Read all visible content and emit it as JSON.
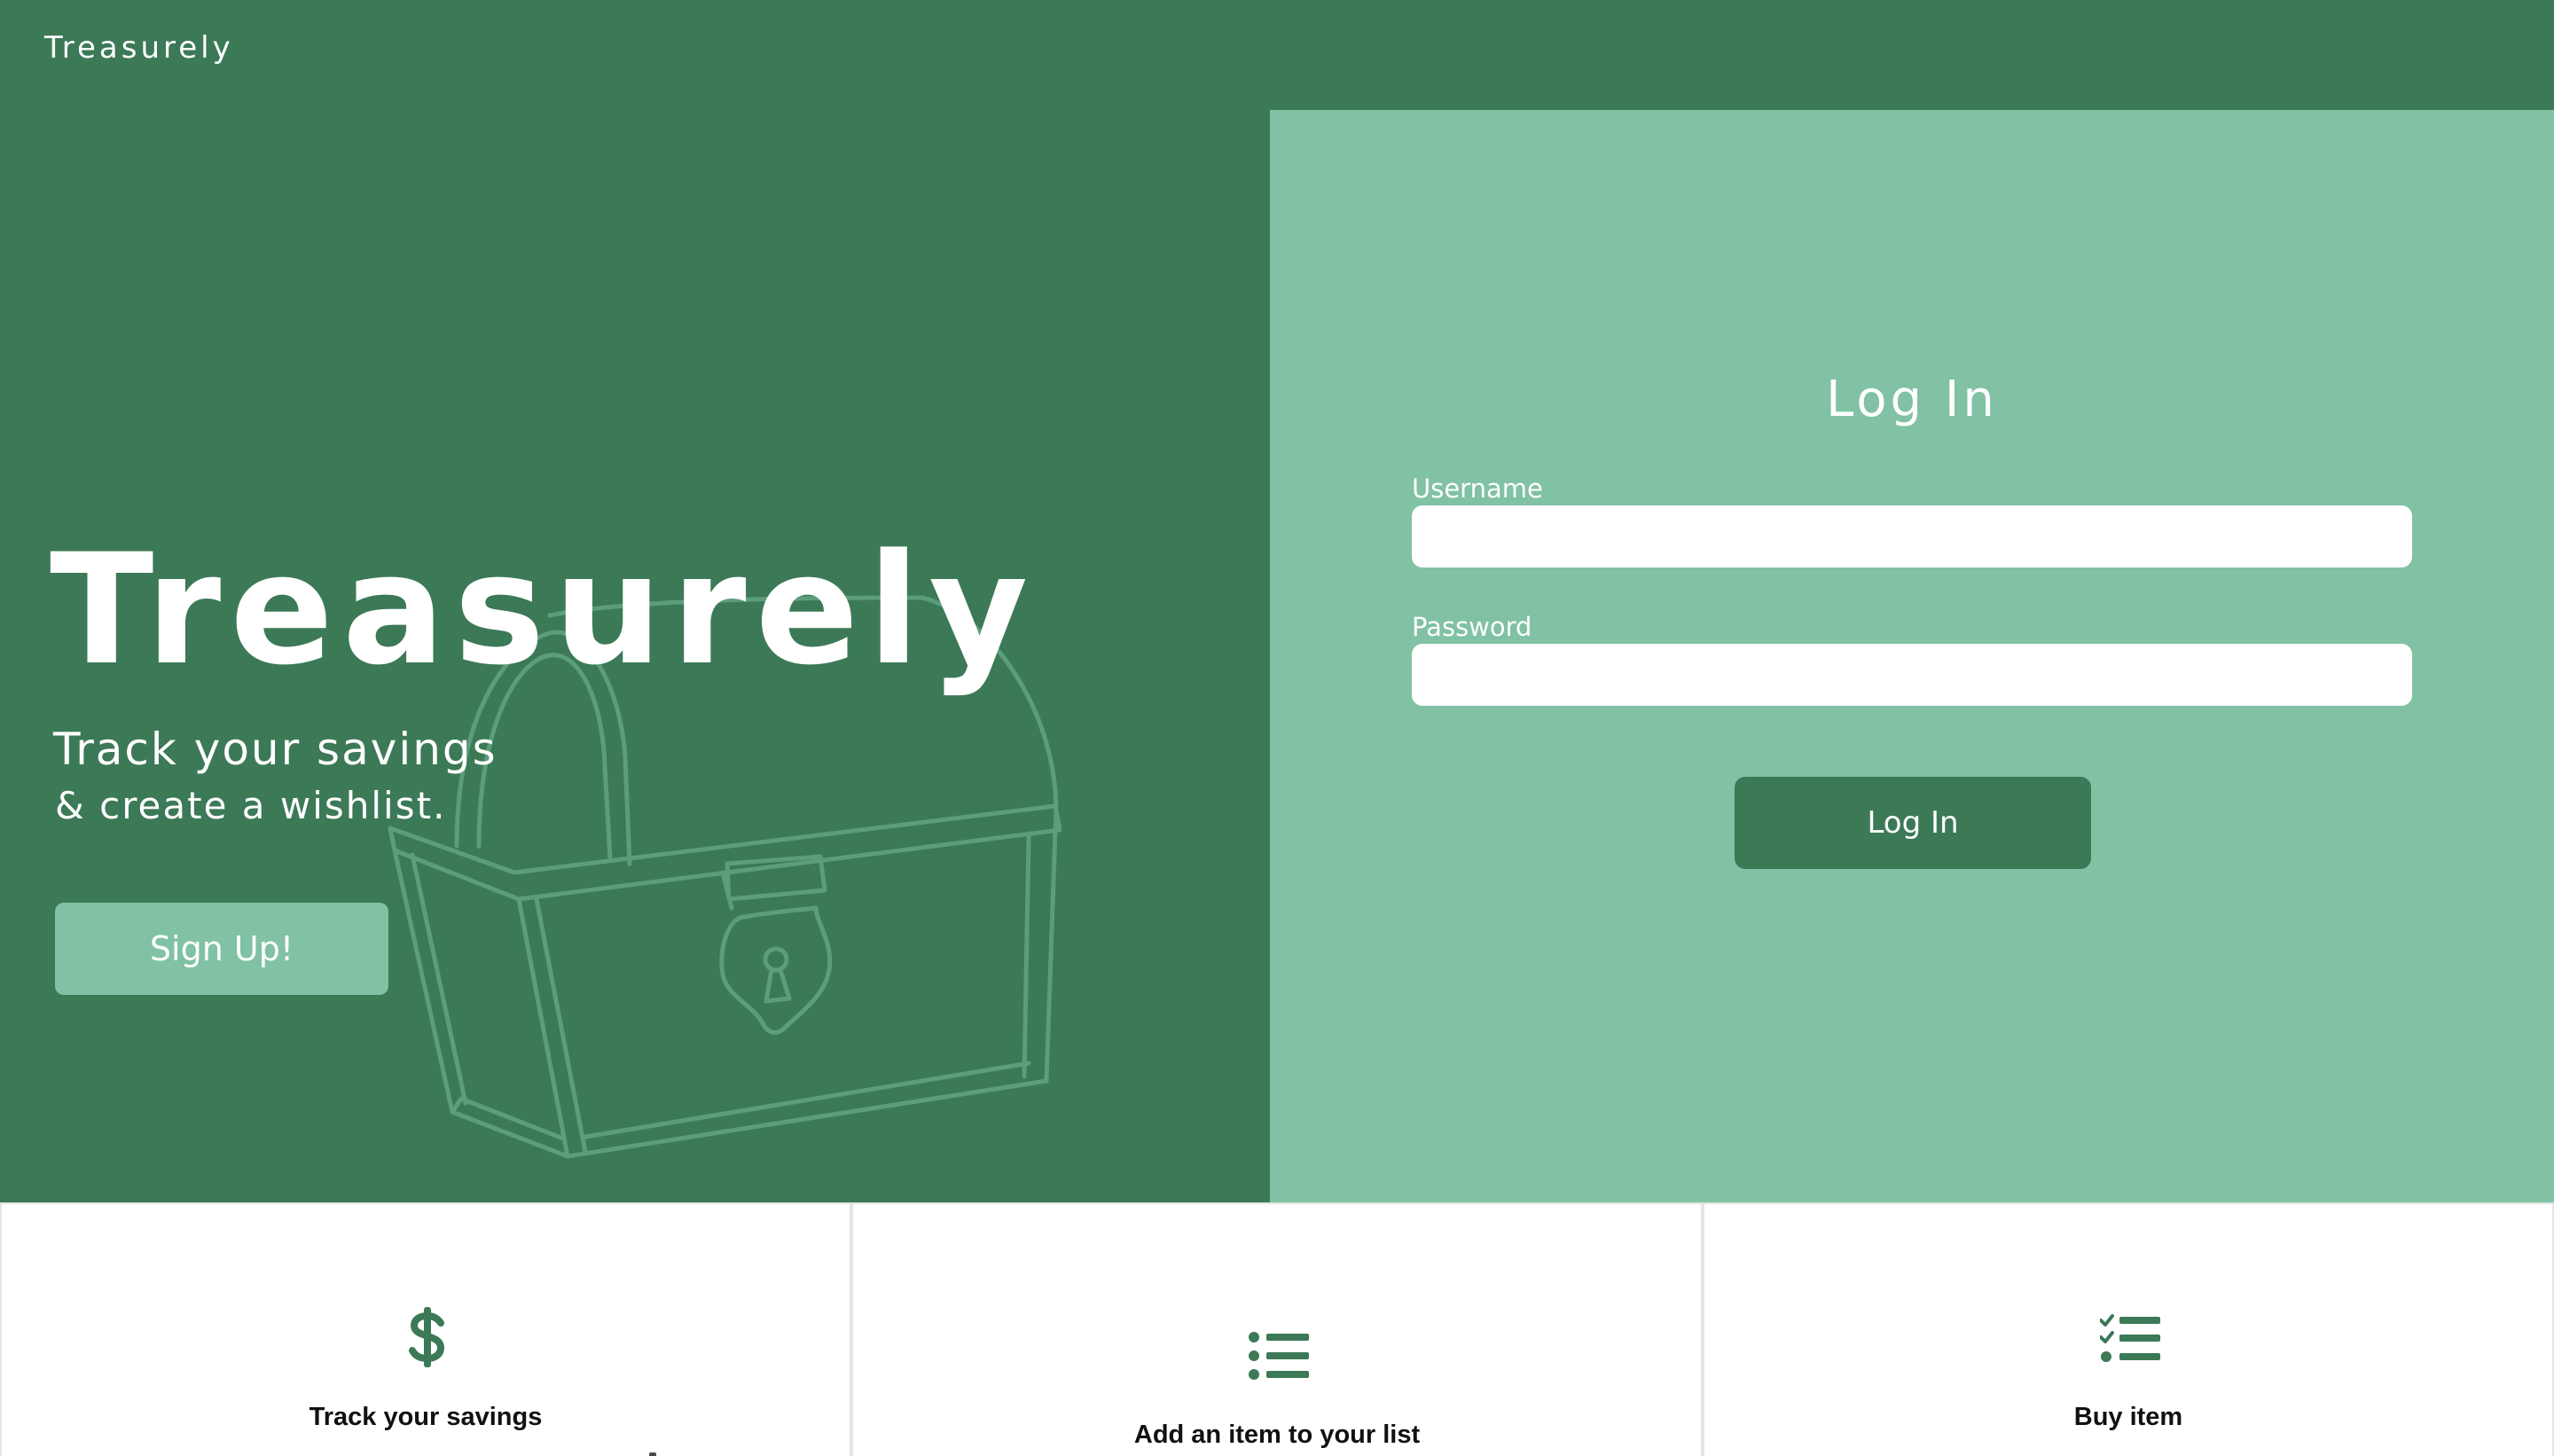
{
  "nav": {
    "brand": "Treasurely"
  },
  "hero": {
    "title": "Treasurely",
    "subtitle_line1": "Track your savings",
    "subtitle_line2": "& create a wishlist.",
    "signup_label": "Sign Up!",
    "illustration": "treasure-chest-icon"
  },
  "login": {
    "title": "Log In",
    "username_label": "Username",
    "username_value": "",
    "password_label": "Password",
    "password_value": "",
    "button_label": "Log In"
  },
  "features": [
    {
      "label": "Track your savings",
      "icon": "dollar-icon"
    },
    {
      "label": "Add an item to your list",
      "icon": "list-icon"
    },
    {
      "label": "Buy item",
      "icon": "checklist-icon"
    }
  ],
  "colors": {
    "primary_green": "#3c7957",
    "light_green": "#80c2a3",
    "white": "#ffffff",
    "card_border": "#e4e4e4"
  }
}
